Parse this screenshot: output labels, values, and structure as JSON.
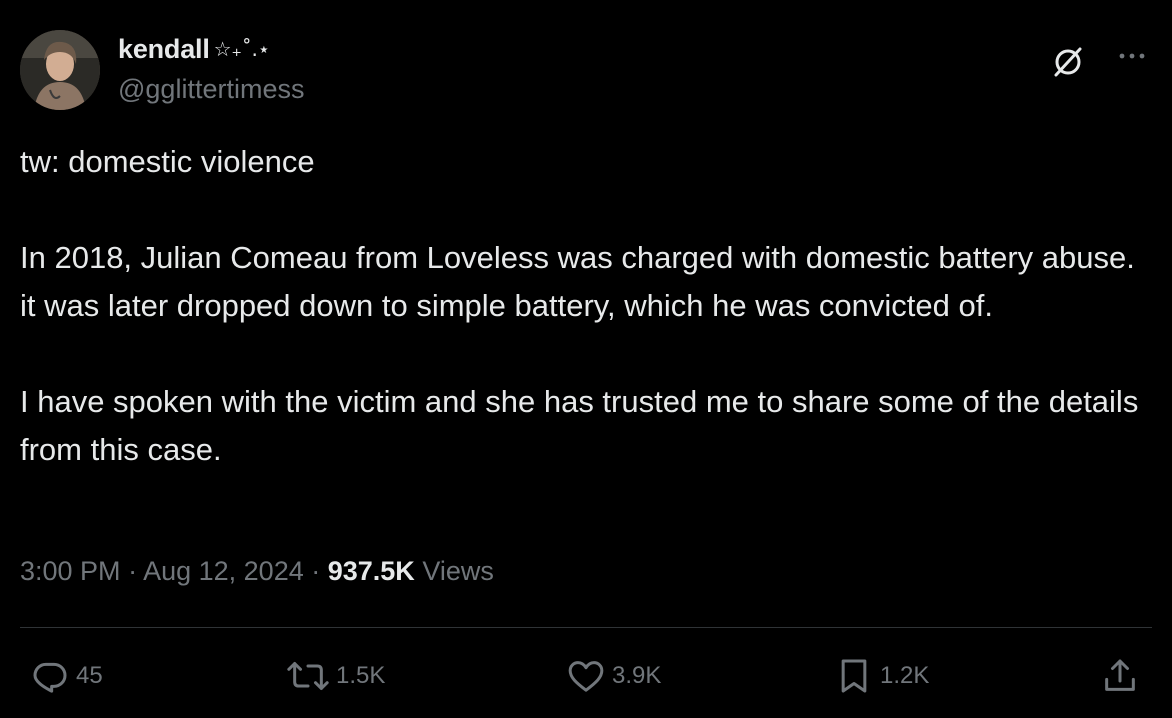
{
  "author": {
    "display_name": "kendall",
    "name_decoration": "☆₊˚.⋆",
    "handle": "@gglittertimess"
  },
  "header_icons": {
    "grok": "grok-icon",
    "more": "more-icon"
  },
  "post": {
    "paragraphs": [
      "tw: domestic violence",
      "In 2018, Julian Comeau from Loveless was charged with domestic battery abuse. it was later dropped down to simple battery, which he was convicted of.",
      "I have spoken with the victim and she has trusted me to share some of the details from this case."
    ]
  },
  "meta": {
    "time": "3:00 PM",
    "separator": " · ",
    "date": "Aug 12, 2024",
    "views_count": "937.5K",
    "views_label": " Views"
  },
  "actions": {
    "replies": "45",
    "reposts": "1.5K",
    "likes": "3.9K",
    "bookmarks": "1.2K"
  },
  "colors": {
    "background": "#000000",
    "primary_text": "#e7e9ea",
    "secondary_text": "#71767b",
    "divider": "#2f3336"
  }
}
